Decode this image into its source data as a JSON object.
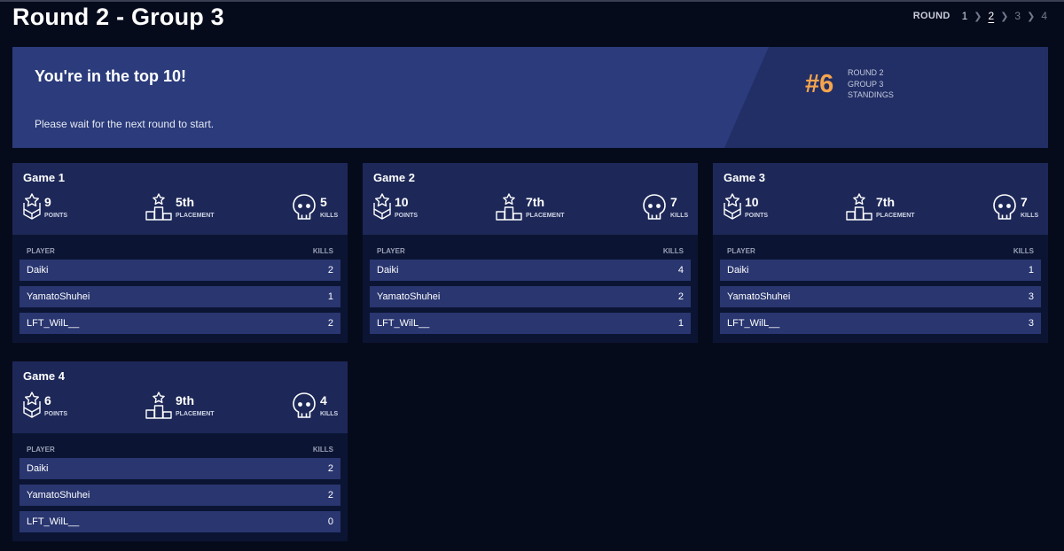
{
  "header": {
    "title": "Round 2 - Group 3",
    "round_nav": {
      "label": "ROUND",
      "rounds": [
        "1",
        "2",
        "3",
        "4"
      ],
      "active": "2"
    }
  },
  "banner": {
    "title": "You're in the top 10!",
    "message": "Please wait for the next round to start.",
    "rank": "#6",
    "standing_lines": [
      "ROUND 2",
      "GROUP 3",
      "STANDINGS"
    ]
  },
  "colors": {
    "accent": "#f6a54c",
    "banner": "#2b3b7b",
    "card_head": "#1d2858",
    "row": "#293670",
    "background": "#060b1c"
  },
  "icons": {
    "points": "chevron-star-icon",
    "placement": "podium-icon",
    "kills": "skull-icon"
  },
  "table_headers": {
    "player": "PLAYER",
    "kills": "KILLS"
  },
  "games": [
    {
      "title": "Game 1",
      "points": {
        "value": "9",
        "label": "POINTS"
      },
      "placement": {
        "value": "5th",
        "label": "PLACEMENT"
      },
      "kills": {
        "value": "5",
        "label": "KILLS"
      },
      "players": [
        {
          "name": "Daiki",
          "kills": "2"
        },
        {
          "name": "YamatoShuhei",
          "kills": "1"
        },
        {
          "name": "LFT_WilL__",
          "kills": "2"
        }
      ]
    },
    {
      "title": "Game 2",
      "points": {
        "value": "10",
        "label": "POINTS"
      },
      "placement": {
        "value": "7th",
        "label": "PLACEMENT"
      },
      "kills": {
        "value": "7",
        "label": "KILLS"
      },
      "players": [
        {
          "name": "Daiki",
          "kills": "4"
        },
        {
          "name": "YamatoShuhei",
          "kills": "2"
        },
        {
          "name": "LFT_WilL__",
          "kills": "1"
        }
      ]
    },
    {
      "title": "Game 3",
      "points": {
        "value": "10",
        "label": "POINTS"
      },
      "placement": {
        "value": "7th",
        "label": "PLACEMENT"
      },
      "kills": {
        "value": "7",
        "label": "KILLS"
      },
      "players": [
        {
          "name": "Daiki",
          "kills": "1"
        },
        {
          "name": "YamatoShuhei",
          "kills": "3"
        },
        {
          "name": "LFT_WilL__",
          "kills": "3"
        }
      ]
    },
    {
      "title": "Game 4",
      "points": {
        "value": "6",
        "label": "POINTS"
      },
      "placement": {
        "value": "9th",
        "label": "PLACEMENT"
      },
      "kills": {
        "value": "4",
        "label": "KILLS"
      },
      "players": [
        {
          "name": "Daiki",
          "kills": "2"
        },
        {
          "name": "YamatoShuhei",
          "kills": "2"
        },
        {
          "name": "LFT_WilL__",
          "kills": "0"
        }
      ]
    }
  ]
}
